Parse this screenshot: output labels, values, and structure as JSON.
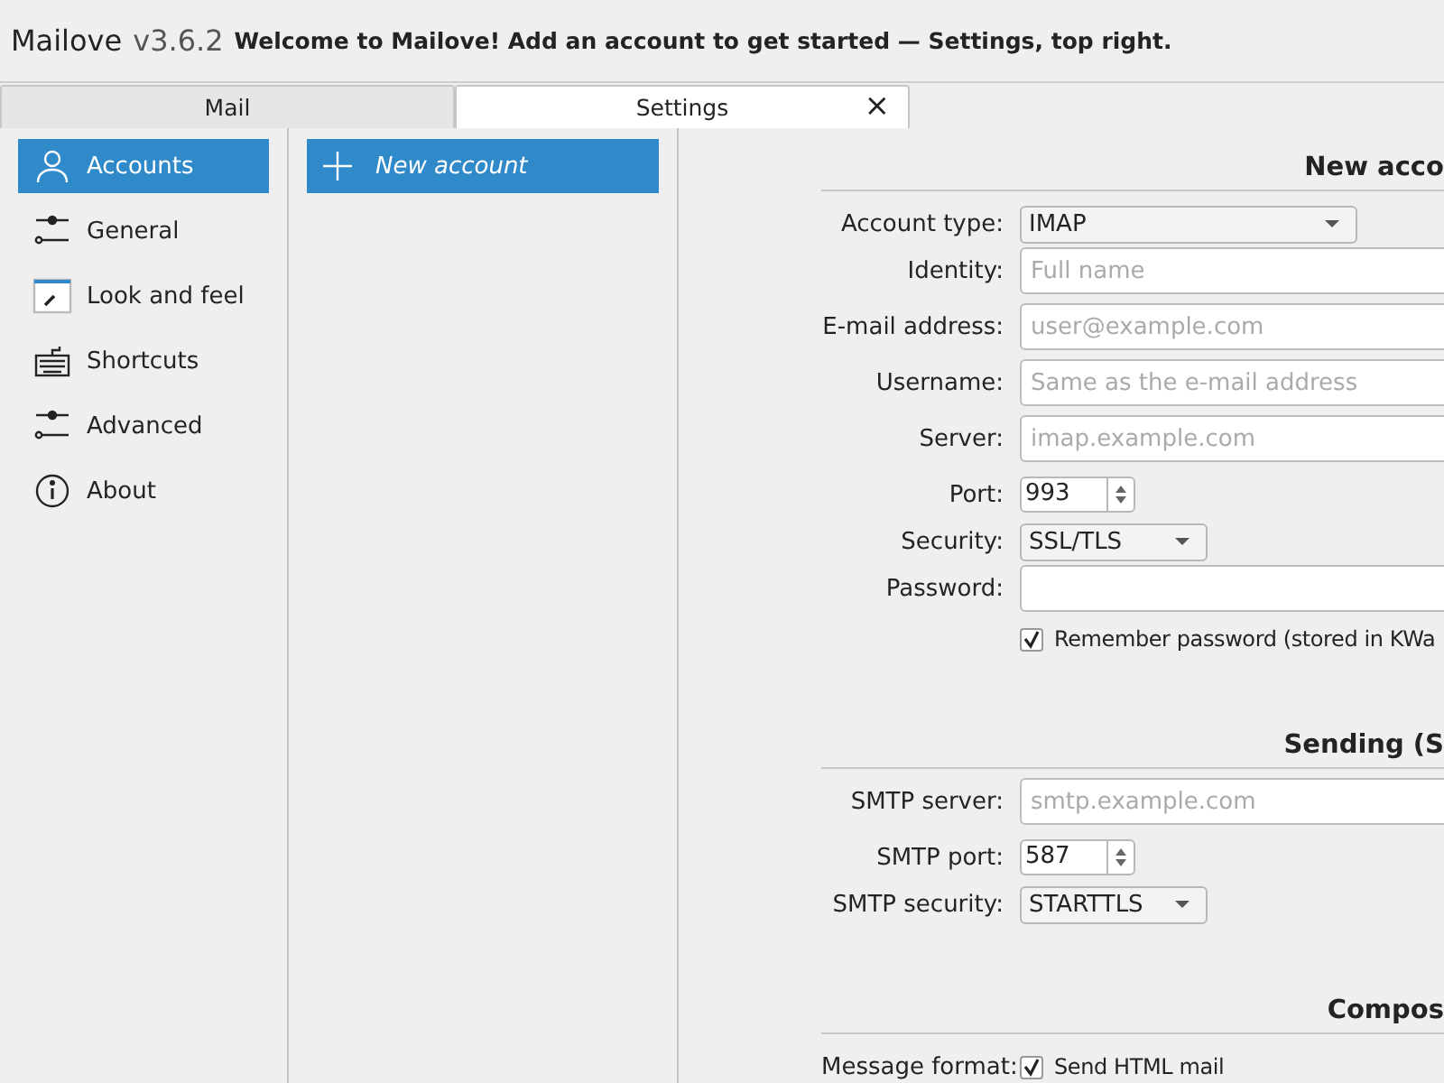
{
  "header": {
    "app_name": "Mailove",
    "version": "v3.6.2",
    "message": "Welcome to Mailove! Add an account to get started — Settings, top right."
  },
  "tabs": [
    {
      "label": "Mail",
      "selected": false
    },
    {
      "label": "Settings",
      "selected": true,
      "close_glyph": "×"
    }
  ],
  "sidebar": {
    "items": [
      {
        "label": "Accounts",
        "selected": true
      },
      {
        "label": "General",
        "selected": false
      },
      {
        "label": "Look and feel",
        "selected": false
      },
      {
        "label": "Shortcuts",
        "selected": false
      },
      {
        "label": "Advanced",
        "selected": false
      },
      {
        "label": "About",
        "selected": false
      }
    ]
  },
  "accounts_list": {
    "items": [
      {
        "label": "New account",
        "selected": true
      }
    ]
  },
  "sections": [
    {
      "title": "New acco",
      "fields": [
        {
          "kind": "combo",
          "label": "Account type:",
          "value": "IMAP",
          "wide": true
        },
        {
          "kind": "text",
          "label": "Identity:",
          "placeholder": "Full name"
        },
        {
          "kind": "text",
          "label": "E-mail address:",
          "placeholder": "user@example.com"
        },
        {
          "kind": "text",
          "label": "Username:",
          "placeholder": "Same as the e-mail address"
        },
        {
          "kind": "text",
          "label": "Server:",
          "placeholder": "imap.example.com"
        },
        {
          "kind": "spin",
          "label": "Port:",
          "value": "993"
        },
        {
          "kind": "combo",
          "label": "Security:",
          "value": "SSL/TLS",
          "wide": false
        },
        {
          "kind": "password",
          "label": "Password:"
        },
        {
          "kind": "checkbox",
          "text": "Remember password (stored in KWa",
          "checked": true
        }
      ]
    },
    {
      "title": "Sending (S",
      "fields": [
        {
          "kind": "text",
          "label": "SMTP server:",
          "placeholder": "smtp.example.com"
        },
        {
          "kind": "spin",
          "label": "SMTP port:",
          "value": "587"
        },
        {
          "kind": "combo",
          "label": "SMTP security:",
          "value": "STARTTLS",
          "wide": false
        }
      ]
    },
    {
      "title": "Compos",
      "fields": [
        {
          "kind": "checkbox",
          "label": "Message format:",
          "text": "Send HTML mail",
          "checked": true
        }
      ]
    }
  ]
}
